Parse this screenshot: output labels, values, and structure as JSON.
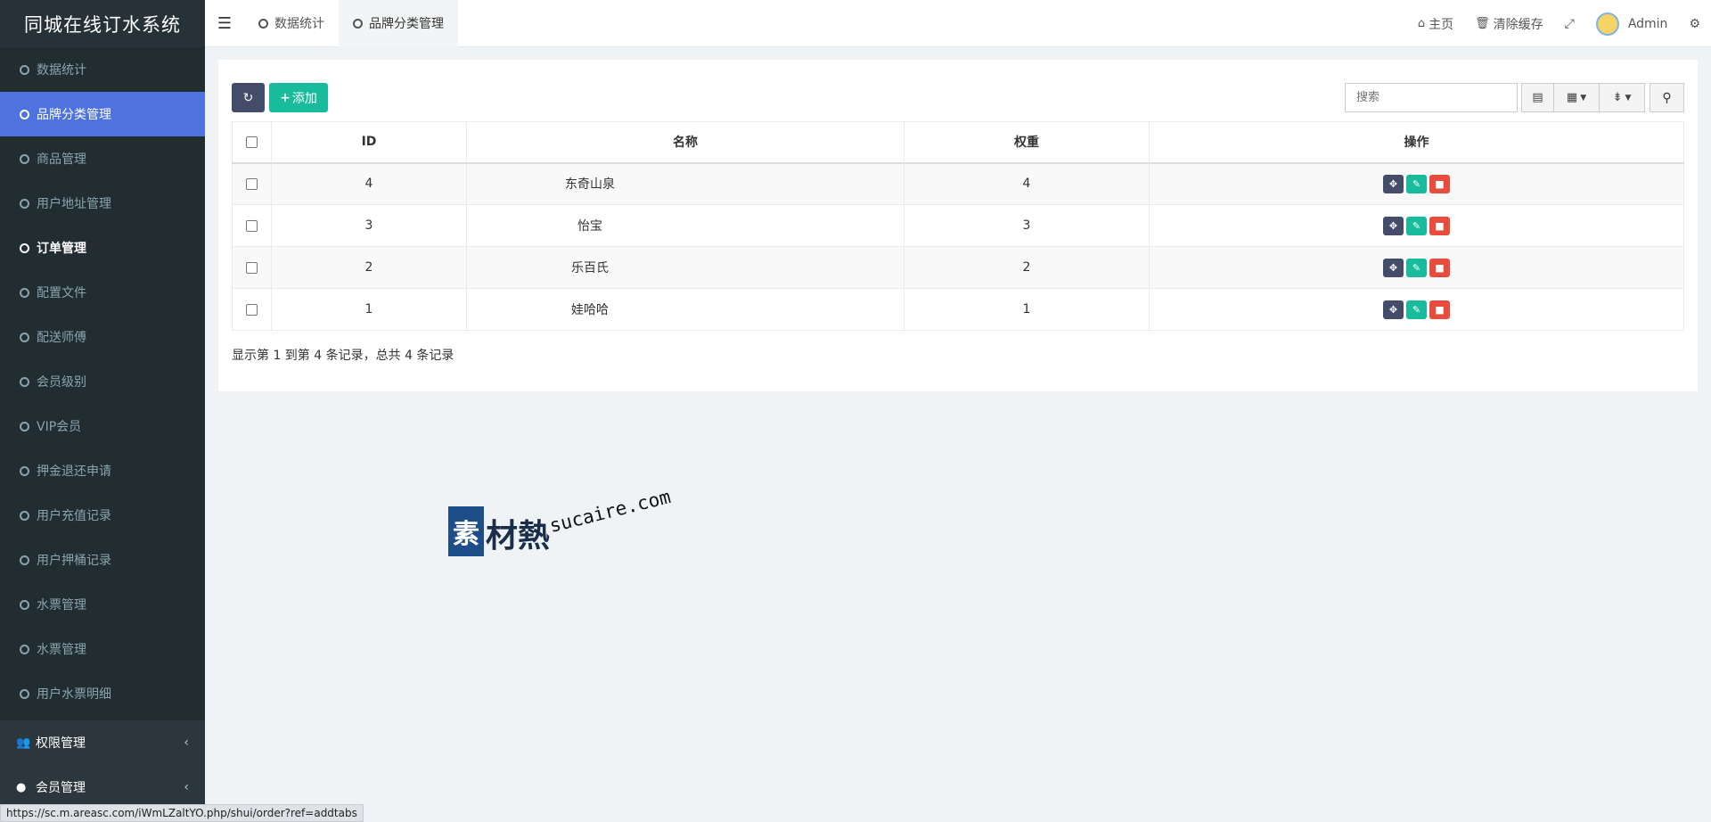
{
  "brand": "同城在线订水系统",
  "sidebar": {
    "items": [
      {
        "label": "数据统计"
      },
      {
        "label": "品牌分类管理"
      },
      {
        "label": "商品管理"
      },
      {
        "label": "用户地址管理"
      },
      {
        "label": "订单管理"
      },
      {
        "label": "配置文件"
      },
      {
        "label": "配送师傅"
      },
      {
        "label": "会员级别"
      },
      {
        "label": "VIP会员"
      },
      {
        "label": "押金退还申请"
      },
      {
        "label": "用户充值记录"
      },
      {
        "label": "用户押桶记录"
      },
      {
        "label": "水票管理"
      },
      {
        "label": "水票管理"
      },
      {
        "label": "用户水票明细"
      }
    ],
    "groups": [
      {
        "label": "权限管理"
      },
      {
        "label": "会员管理"
      }
    ]
  },
  "topbar": {
    "tabs": [
      {
        "label": "数据统计"
      },
      {
        "label": "品牌分类管理"
      }
    ],
    "home": "主页",
    "clear_cache": "清除缓存",
    "user": "Admin"
  },
  "toolbar": {
    "add_label": "添加",
    "search_placeholder": "搜索"
  },
  "table": {
    "headers": [
      "ID",
      "名称",
      "权重",
      "操作"
    ],
    "rows": [
      {
        "id": "4",
        "name": "东奇山泉",
        "weight": "4"
      },
      {
        "id": "3",
        "name": "怡宝",
        "weight": "3"
      },
      {
        "id": "2",
        "name": "乐百氏",
        "weight": "2"
      },
      {
        "id": "1",
        "name": "娃哈哈",
        "weight": "1"
      }
    ],
    "summary": "显示第 1 到第 4 条记录，总共 4 条记录"
  },
  "watermark": {
    "box_char": "素",
    "text": "材熱",
    "url": "sucaire.com"
  },
  "status_url": "https://sc.m.areasc.com/iWmLZaltYO.php/shui/order?ref=addtabs",
  "colors": {
    "sidebar_bg": "#222d32",
    "active_item": "#4e73df",
    "success": "#18bc9c",
    "danger": "#e74c3c",
    "dark_btn": "#444c69"
  }
}
